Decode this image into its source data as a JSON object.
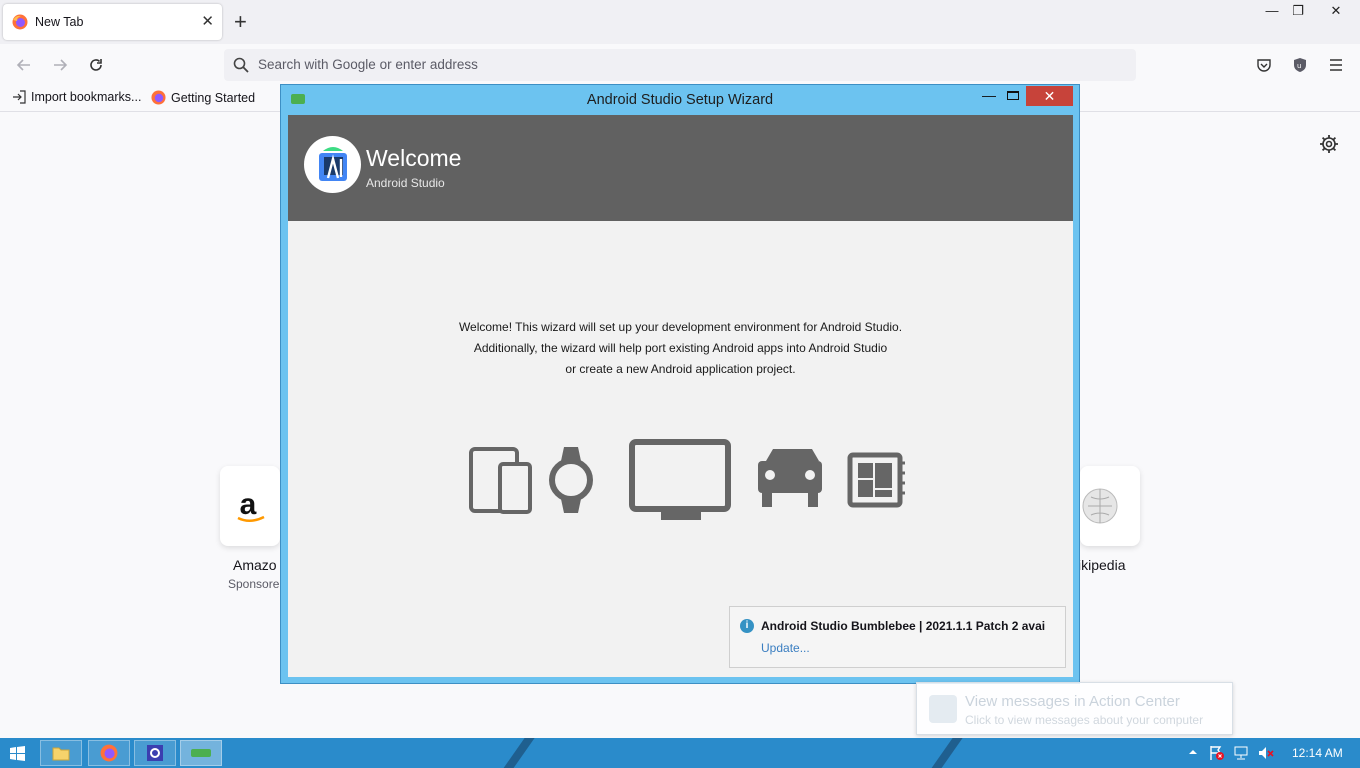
{
  "browser": {
    "tab_title": "New Tab",
    "url_placeholder": "Search with Google or enter address",
    "bookmarks": [
      "Import bookmarks...",
      "Getting Started"
    ],
    "shortcuts": [
      {
        "label": "Amazo",
        "sub": "Sponsore"
      },
      {
        "label": "ikipedia",
        "sub": ""
      }
    ]
  },
  "wizard": {
    "window_title": "Android Studio Setup Wizard",
    "heading": "Welcome",
    "subheading": "Android Studio",
    "intro_lines": [
      "Welcome! This wizard will set up your development environment for Android Studio.",
      "Additionally, the wizard will help port existing Android apps into Android Studio",
      "or create a new Android application project."
    ],
    "device_icons": [
      "phone-tablet-icon",
      "watch-icon",
      "tv-icon",
      "car-icon",
      "things-icon"
    ],
    "notification": {
      "title": "Android Studio Bumblebee | 2021.1.1 Patch 2 avai",
      "link": "Update..."
    }
  },
  "toast": {
    "title": "View messages in Action Center",
    "body": "Click to view messages about your computer"
  },
  "taskbar": {
    "time": "12:14 AM"
  },
  "colors": {
    "wizard_border": "#6cc3f0",
    "wizard_header": "#616161",
    "close_button": "#c7433a",
    "taskbar": "#2a8bcb"
  }
}
